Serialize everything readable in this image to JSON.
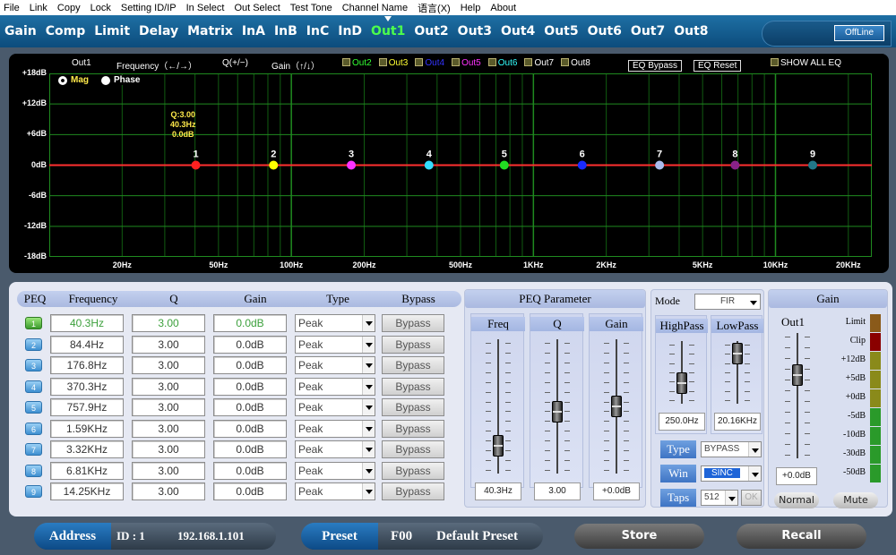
{
  "menu": [
    "File",
    "Link",
    "Copy",
    "Lock",
    "Setting ID/IP",
    "In Select",
    "Out Select",
    "Test Tone",
    "Channel Name",
    "语言(X)",
    "Help",
    "About"
  ],
  "tabs": [
    {
      "label": "Gain",
      "active": false
    },
    {
      "label": "Comp",
      "active": false
    },
    {
      "label": "Limit",
      "active": false
    },
    {
      "label": "Delay",
      "active": false
    },
    {
      "label": "Matrix",
      "active": false
    },
    {
      "label": "InA",
      "active": false
    },
    {
      "label": "InB",
      "active": false
    },
    {
      "label": "InC",
      "active": false
    },
    {
      "label": "InD",
      "active": false
    },
    {
      "label": "Out1",
      "active": true
    },
    {
      "label": "Out2",
      "active": false
    },
    {
      "label": "Out3",
      "active": false
    },
    {
      "label": "Out4",
      "active": false
    },
    {
      "label": "Out5",
      "active": false
    },
    {
      "label": "Out6",
      "active": false
    },
    {
      "label": "Out7",
      "active": false
    },
    {
      "label": "Out8",
      "active": false
    }
  ],
  "status": "OffLine",
  "eq": {
    "channel": "Out1",
    "freq_hint": "Frequency（←/→）",
    "q_hint": "Q(+/−)",
    "gain_hint": "Gain（↑/↓）",
    "outs": [
      {
        "label": "Out2",
        "color": "#33ff33"
      },
      {
        "label": "Out3",
        "color": "#ffff33"
      },
      {
        "label": "Out4",
        "color": "#3333ff"
      },
      {
        "label": "Out5",
        "color": "#ff33ff"
      },
      {
        "label": "Out6",
        "color": "#33ffff"
      },
      {
        "label": "Out7",
        "color": "#ffffff"
      },
      {
        "label": "Out8",
        "color": "#ffffff"
      }
    ],
    "bypass_btn": "EQ Bypass",
    "reset_btn": "EQ Reset",
    "show_all": "SHOW ALL EQ",
    "mag": "Mag",
    "phase": "Phase",
    "y_labels": [
      "+18dB",
      "+12dB",
      "+6dB",
      "0dB",
      "-6dB",
      "-12dB",
      "-18dB"
    ],
    "x_labels": [
      "20Hz",
      "50Hz",
      "100Hz",
      "200Hz",
      "500Hz",
      "1KHz",
      "2KHz",
      "5KHz",
      "10KHz",
      "20KHz"
    ],
    "tooltip": {
      "q": "Q:3.00",
      "freq": "40.3Hz",
      "gain": "0.0dB"
    },
    "points": [
      {
        "n": "1",
        "freq": 40.3,
        "color": "#ff2020"
      },
      {
        "n": "2",
        "freq": 84.4,
        "color": "#ffff00"
      },
      {
        "n": "3",
        "freq": 176.8,
        "color": "#ff33ff"
      },
      {
        "n": "4",
        "freq": 370.3,
        "color": "#33ddff"
      },
      {
        "n": "5",
        "freq": 757.9,
        "color": "#22dd22"
      },
      {
        "n": "6",
        "freq": 1590,
        "color": "#1a2aff"
      },
      {
        "n": "7",
        "freq": 3320,
        "color": "#aabbee"
      },
      {
        "n": "8",
        "freq": 6810,
        "color": "#882288"
      },
      {
        "n": "9",
        "freq": 14250,
        "color": "#227788"
      }
    ]
  },
  "peq": {
    "headers": {
      "peq": "PEQ",
      "freq": "Frequency",
      "q": "Q",
      "gain": "Gain",
      "type": "Type",
      "bypass": "Bypass"
    },
    "rows": [
      {
        "n": "1",
        "freq": "40.3Hz",
        "q": "3.00",
        "gain": "0.0dB",
        "type": "Peak",
        "bypass": "Bypass",
        "active": true
      },
      {
        "n": "2",
        "freq": "84.4Hz",
        "q": "3.00",
        "gain": "0.0dB",
        "type": "Peak",
        "bypass": "Bypass",
        "active": false
      },
      {
        "n": "3",
        "freq": "176.8Hz",
        "q": "3.00",
        "gain": "0.0dB",
        "type": "Peak",
        "bypass": "Bypass",
        "active": false
      },
      {
        "n": "4",
        "freq": "370.3Hz",
        "q": "3.00",
        "gain": "0.0dB",
        "type": "Peak",
        "bypass": "Bypass",
        "active": false
      },
      {
        "n": "5",
        "freq": "757.9Hz",
        "q": "3.00",
        "gain": "0.0dB",
        "type": "Peak",
        "bypass": "Bypass",
        "active": false
      },
      {
        "n": "6",
        "freq": "1.59KHz",
        "q": "3.00",
        "gain": "0.0dB",
        "type": "Peak",
        "bypass": "Bypass",
        "active": false
      },
      {
        "n": "7",
        "freq": "3.32KHz",
        "q": "3.00",
        "gain": "0.0dB",
        "type": "Peak",
        "bypass": "Bypass",
        "active": false
      },
      {
        "n": "8",
        "freq": "6.81KHz",
        "q": "3.00",
        "gain": "0.0dB",
        "type": "Peak",
        "bypass": "Bypass",
        "active": false
      },
      {
        "n": "9",
        "freq": "14.25KHz",
        "q": "3.00",
        "gain": "0.0dB",
        "type": "Peak",
        "bypass": "Bypass",
        "active": false
      }
    ]
  },
  "param": {
    "title": "PEQ Parameter",
    "freq_label": "Freq",
    "q_label": "Q",
    "gain_label": "Gain",
    "freq_value": "40.3Hz",
    "q_value": "3.00",
    "gain_value": "+0.0dB",
    "freq_level": 0.15,
    "q_level": 0.45,
    "gain_level": 0.5
  },
  "filters": {
    "mode_label": "Mode",
    "mode_value": "FIR",
    "hp_label": "HighPass",
    "lp_label": "LowPass",
    "hp_value": "250.0Hz",
    "lp_value": "20.16KHz",
    "hp_level": 0.25,
    "lp_level": 0.95,
    "type_label": "Type",
    "type_value": "BYPASS",
    "win_label": "Win",
    "win_value": "SINC",
    "taps_label": "Taps",
    "taps_value": "512",
    "ok_label": "OK"
  },
  "gain": {
    "title": "Gain",
    "channel": "Out1",
    "value": "+0.0dB",
    "level": 0.7,
    "meter_labels": [
      "Limit",
      "Clip",
      "+12dB",
      "+5dB",
      "+0dB",
      "-5dB",
      "-10dB",
      "-30dB",
      "-50dB"
    ],
    "normal": "Normal",
    "mute": "Mute"
  },
  "footer": {
    "address": "Address",
    "id": "ID : 1",
    "ip": "192.168.1.101",
    "preset": "Preset",
    "preset_id": "F00",
    "preset_name": "Default Preset",
    "store": "Store",
    "recall": "Recall"
  }
}
